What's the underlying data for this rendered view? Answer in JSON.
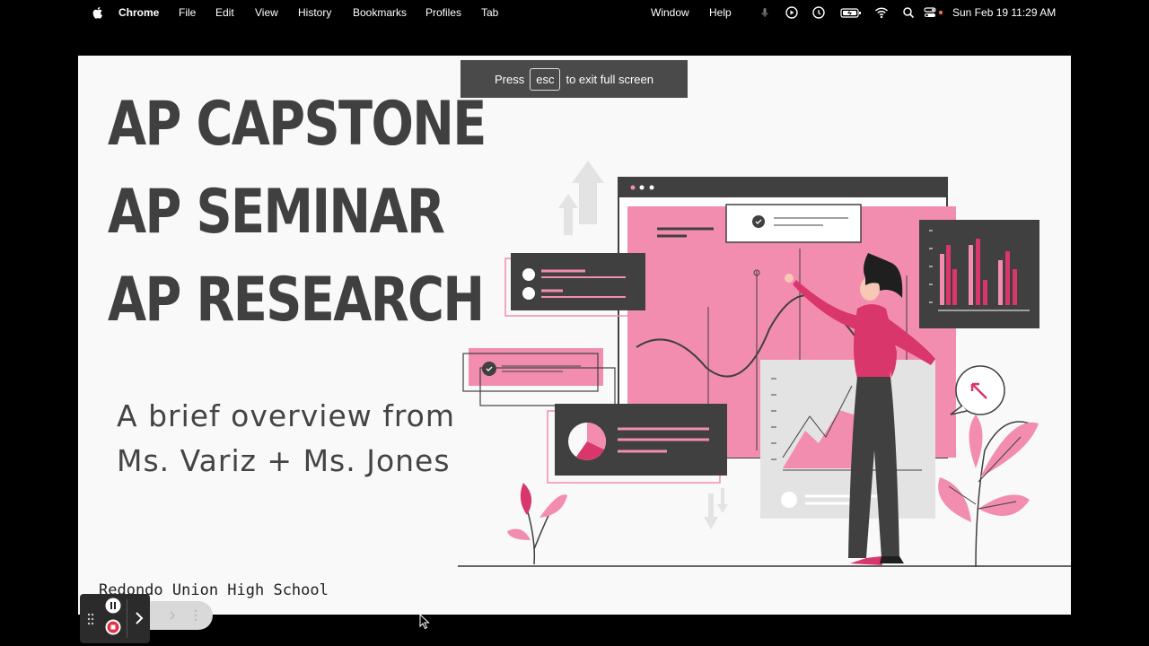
{
  "menubar": {
    "app_name": "Chrome",
    "items": [
      "File",
      "Edit",
      "View",
      "History",
      "Bookmarks",
      "Profiles",
      "Tab"
    ],
    "right_items": [
      "Window",
      "Help"
    ],
    "clock": "Sun Feb 19  11:29 AM"
  },
  "fullscreen_banner": {
    "prefix": "Press",
    "key": "esc",
    "suffix": "to exit full screen"
  },
  "slide": {
    "title_lines": [
      "AP CAPSTONE",
      "AP SEMINAR",
      "AP RESEARCH"
    ],
    "subtitle_lines": [
      "A brief overview from",
      "Ms. Variz + Ms. Jones"
    ],
    "school": "Redondo Union High School",
    "accent_color": "#f28db0",
    "accent_dark": "#d9366b",
    "dark_gray": "#404040"
  },
  "recorder": {
    "icons": [
      "drag-handle-icon",
      "pause-icon",
      "stop-icon",
      "chevron-right-icon"
    ]
  }
}
